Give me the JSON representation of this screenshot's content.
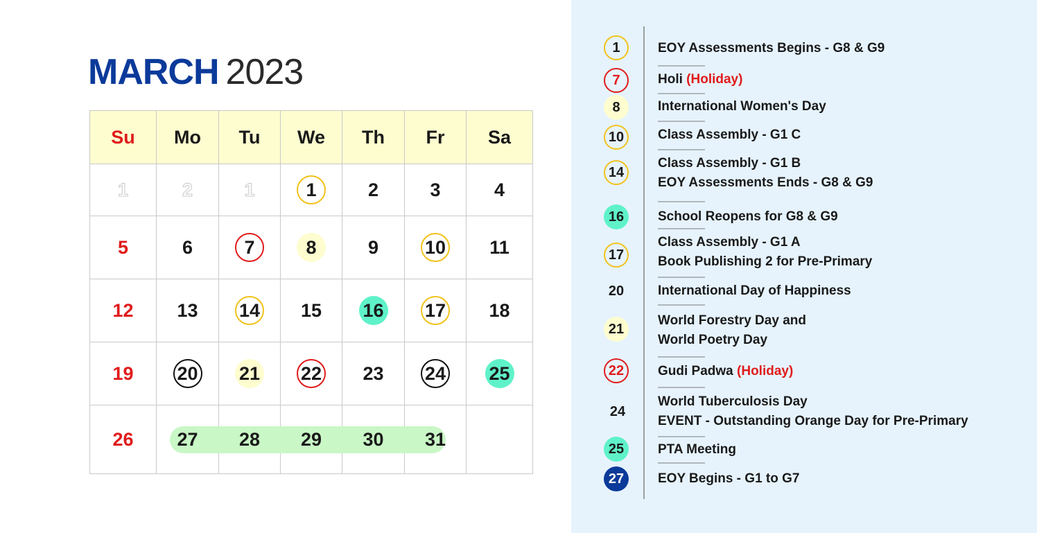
{
  "title": {
    "month": "MARCH",
    "year": "2023"
  },
  "weekdays": [
    "Su",
    "Mo",
    "Tu",
    "We",
    "Th",
    "Fr",
    "Sa"
  ],
  "calendar": {
    "row1": [
      "1",
      "2",
      "1",
      "1",
      "2",
      "3",
      "4"
    ],
    "row2": [
      "5",
      "6",
      "7",
      "8",
      "9",
      "10",
      "11"
    ],
    "row3": [
      "12",
      "13",
      "14",
      "15",
      "16",
      "17",
      "18"
    ],
    "row4": [
      "19",
      "20",
      "21",
      "22",
      "23",
      "24",
      "25"
    ],
    "row5": [
      "26",
      "27",
      "28",
      "29",
      "30",
      "31",
      ""
    ]
  },
  "events": [
    {
      "day": "1",
      "lines": [
        "EOY Assessments Begins - G8 & G9"
      ]
    },
    {
      "day": "7",
      "text": "Holi",
      "tag": "(Holiday)"
    },
    {
      "day": "8",
      "lines": [
        "International Women's Day"
      ]
    },
    {
      "day": "10",
      "lines": [
        "Class Assembly - G1 C"
      ]
    },
    {
      "day": "14",
      "lines": [
        "Class Assembly - G1 B",
        "EOY Assessments Ends - G8 & G9"
      ]
    },
    {
      "day": "16",
      "lines": [
        "School Reopens for G8 & G9"
      ]
    },
    {
      "day": "17",
      "lines": [
        "Class Assembly - G1 A",
        "Book Publishing 2 for Pre-Primary"
      ]
    },
    {
      "day": "20",
      "lines": [
        "International Day of Happiness"
      ]
    },
    {
      "day": "21",
      "lines": [
        "World Forestry Day and",
        "World Poetry Day"
      ]
    },
    {
      "day": "22",
      "text": "Gudi Padwa",
      "tag": "(Holiday)"
    },
    {
      "day": "24",
      "lines": [
        "World Tuberculosis Day",
        "EVENT - Outstanding Orange Day for Pre-Primary"
      ]
    },
    {
      "day": "25",
      "lines": [
        "PTA Meeting"
      ]
    },
    {
      "day": "27",
      "lines": [
        "EOY Begins - G1 to G7"
      ]
    }
  ],
  "colors": {
    "month_title": "#0b3a9a",
    "sunday": "#e01b1b",
    "holiday": "#e01b1b",
    "header_fill": "#fdfdd0",
    "yellow_ring": "#f1c21b",
    "yellow_fill": "#fdfdcf",
    "teal_fill": "#5ff2c9",
    "green_band": "#c9f7c6",
    "navy_badge": "#0b3a9a",
    "right_panel_bg": "#e6f3fd"
  }
}
